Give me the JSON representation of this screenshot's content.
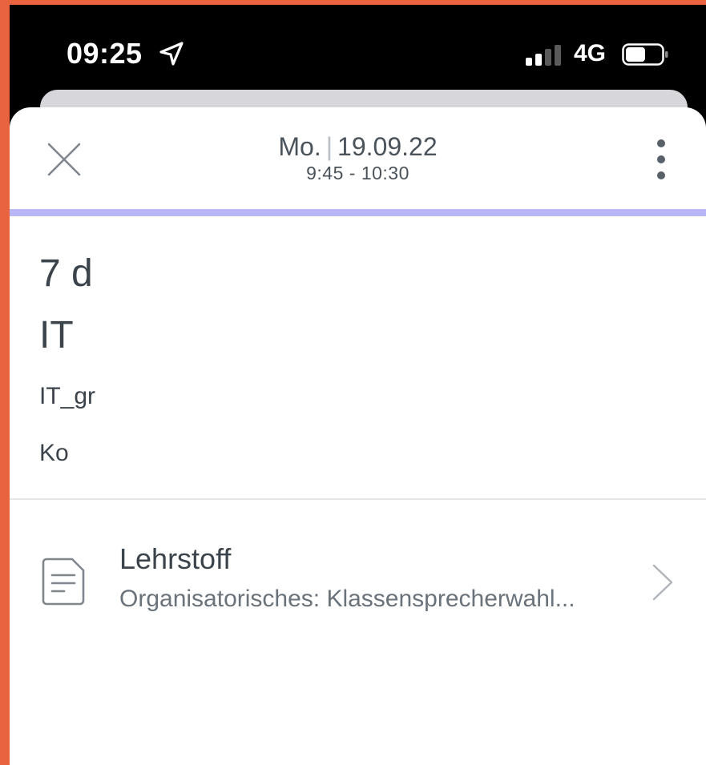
{
  "status_bar": {
    "time": "09:25",
    "network": "4G",
    "location_icon": "location-arrow-icon",
    "signal_icon": "cellular-signal-icon",
    "battery_icon": "battery-icon"
  },
  "header": {
    "day": "Mo.",
    "date": "19.09.22",
    "time_range": "9:45 - 10:30",
    "close_icon": "close-icon",
    "more_icon": "more-vertical-icon"
  },
  "colors": {
    "accent_bar": "#b9b6f7",
    "frame": "#e9633e"
  },
  "lesson": {
    "class_name": "7 d",
    "subject": "IT",
    "group": "IT_gr",
    "teacher": "Ko"
  },
  "topic": {
    "title": "Lehrstoff",
    "text": "Organisatorisches: Klassensprecherwahl...",
    "icon": "document-icon",
    "chevron_icon": "chevron-right-icon"
  }
}
